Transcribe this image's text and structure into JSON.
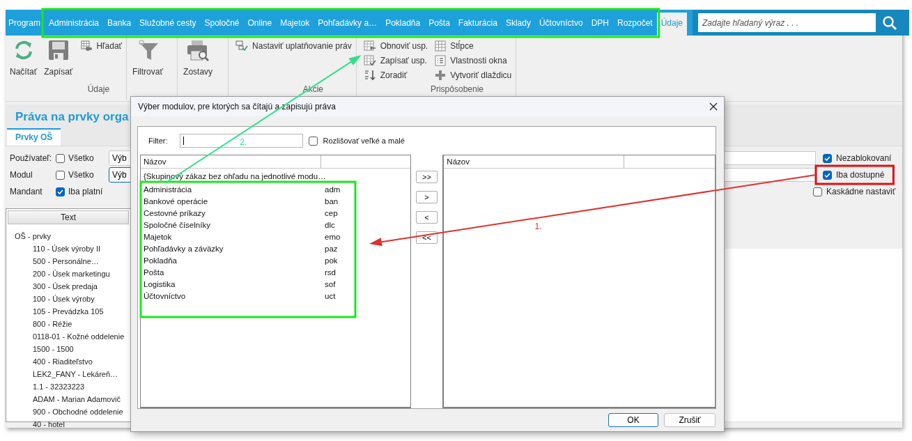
{
  "menu": {
    "items": [
      {
        "label": "Program",
        "selected": false
      },
      {
        "label": "Administrácia",
        "selected": false
      },
      {
        "label": "Banka",
        "selected": false
      },
      {
        "label": "Služobné cesty",
        "selected": false
      },
      {
        "label": "Spoločné",
        "selected": false
      },
      {
        "label": "Online",
        "selected": false
      },
      {
        "label": "Majetok",
        "selected": false
      },
      {
        "label": "Pohľadávky a…",
        "selected": false
      },
      {
        "label": "Pokladňa",
        "selected": false
      },
      {
        "label": "Pošta",
        "selected": false
      },
      {
        "label": "Fakturácia",
        "selected": false
      },
      {
        "label": "Sklady",
        "selected": false
      },
      {
        "label": "Účtovníctvo",
        "selected": false
      },
      {
        "label": "DPH",
        "selected": false
      },
      {
        "label": "Rozpočet",
        "selected": false
      },
      {
        "label": "Údaje",
        "selected": true
      }
    ],
    "search": {
      "placeholder": "Zadajte hľadaný výraz . . ."
    }
  },
  "ribbon": {
    "groups": [
      {
        "label": "Údaje",
        "buttons": [
          {
            "kind": "large",
            "label": "Načítať"
          },
          {
            "kind": "large",
            "label": "Zapísať"
          },
          {
            "kind": "small",
            "label": "Hľadať"
          }
        ]
      },
      {
        "buttons": [
          {
            "kind": "large",
            "label": "Filtrovať"
          }
        ]
      },
      {
        "buttons": [
          {
            "kind": "large",
            "label": "Zostavy"
          }
        ]
      },
      {
        "label": "Akcie",
        "buttons": [
          {
            "kind": "small",
            "label": "Nastaviť uplatňovanie práv"
          }
        ]
      },
      {
        "label": "Prispôsobenie",
        "buttons": [
          {
            "kind": "small",
            "label": "Obnoviť usp."
          },
          {
            "kind": "small",
            "label": "Zapísať usp."
          },
          {
            "kind": "small",
            "label": "Zoradiť"
          },
          {
            "kind": "small",
            "label": "Stĺpce"
          },
          {
            "kind": "small",
            "label": "Vlastnosti okna"
          },
          {
            "kind": "small",
            "label": "Vytvoriť dlaždicu"
          }
        ]
      }
    ]
  },
  "page": {
    "title": "Práva na prvky orga",
    "tabs": [
      {
        "label": "Prvky OŠ",
        "selected": true
      }
    ],
    "filters": [
      {
        "label": "Používateľ:",
        "checkbox": {
          "label": "Všetko",
          "checked": false
        },
        "button": "Výb"
      },
      {
        "label": "Modul",
        "checkbox": {
          "label": "Všetko",
          "checked": false
        },
        "button": "Výb"
      },
      {
        "label": "Mandant",
        "checkbox": {
          "label": "Iba platní",
          "checked": true
        }
      }
    ],
    "options": [
      {
        "label": "Nezablokovaní",
        "checked": true
      },
      {
        "label": "Iba dostupné",
        "checked": true
      },
      {
        "label": "Kaskádne nastaviť",
        "checked": false
      }
    ],
    "tree": {
      "column": "Text",
      "items": [
        {
          "label": "OŠ - prvky",
          "children": [
            {
              "label": "110 - Úsek výroby II"
            },
            {
              "label": "500 - Personálne…"
            },
            {
              "label": "200 - Úsek marketingu"
            },
            {
              "label": "300 - Úsek predaja"
            },
            {
              "label": "100 - Úsek výroby"
            },
            {
              "label": "105 - Prevádzka 105"
            },
            {
              "label": "800 - Réžie"
            },
            {
              "label": "0118-01 - Kožné oddelenie"
            },
            {
              "label": "1500 - 1500"
            },
            {
              "label": "400 - Riaditeľstvo"
            },
            {
              "label": "LEK2_FANY -  Lekáreň…"
            },
            {
              "label": "1.1 - 32323223"
            },
            {
              "label": "ADAM - Marian Adamovič"
            },
            {
              "label": "900 - Obchodné oddelenie"
            },
            {
              "label": "40 - hotel"
            }
          ]
        }
      ]
    }
  },
  "dialog": {
    "title": "Výber modulov, pre ktorých sa čítajú a zapisujú práva",
    "filter": {
      "label": "Filter:"
    },
    "case_sensitive": {
      "label": "Rozlišovať veľké a malé",
      "checked": false
    },
    "source": {
      "column": "Názov",
      "rows": [
        {
          "name": "{Skupinový zákaz bez ohľadu na jednotlivé modu…"
        },
        {
          "name": "Administrácia",
          "code": "adm"
        },
        {
          "name": "Bankové operácie",
          "code": "ban"
        },
        {
          "name": "Cestovné príkazy",
          "code": "cep"
        },
        {
          "name": "Spoločné číselníky",
          "code": "dlc"
        },
        {
          "name": "Majetok",
          "code": "emo"
        },
        {
          "name": "Pohľadávky a záväzky",
          "code": "paz"
        },
        {
          "name": "Pokladňa",
          "code": "pok"
        },
        {
          "name": "Pošta",
          "code": "rsd"
        },
        {
          "name": "Logistika",
          "code": "sof"
        },
        {
          "name": "Účtovníctvo",
          "code": "uct"
        }
      ]
    },
    "move_buttons": [
      ">>",
      ">",
      "<",
      "<<"
    ],
    "target": {
      "column": "Názov"
    },
    "buttons": [
      {
        "label": "OK",
        "default": true
      },
      {
        "label": "Zrušiť",
        "default": false
      }
    ]
  },
  "annotations": [
    {
      "kind": "box",
      "color": "#1ee61e"
    },
    {
      "kind": "box",
      "color": "#1ee61e"
    },
    {
      "kind": "box",
      "color": "#e01010"
    },
    {
      "kind": "arrow",
      "color": "#e03030",
      "label": "1."
    },
    {
      "kind": "arrow",
      "color": "#2fe08a",
      "label": "2."
    }
  ]
}
